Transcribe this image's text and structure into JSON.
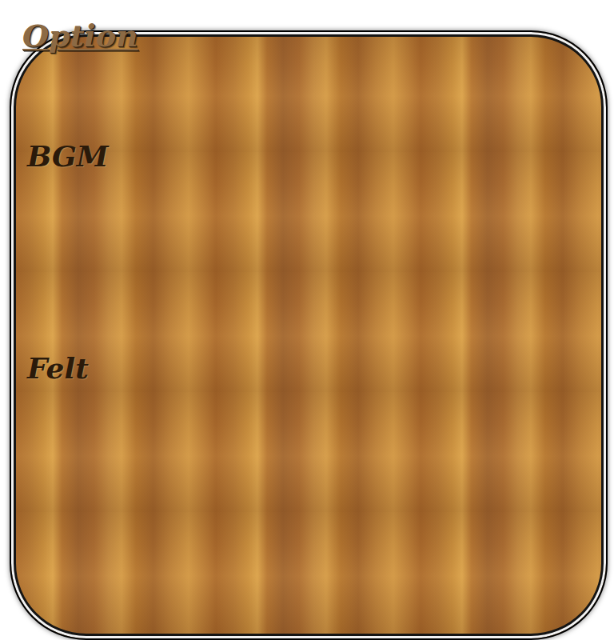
{
  "title": "Option",
  "settings": [
    {
      "label": "BGM"
    },
    {
      "label": "Felt"
    }
  ]
}
